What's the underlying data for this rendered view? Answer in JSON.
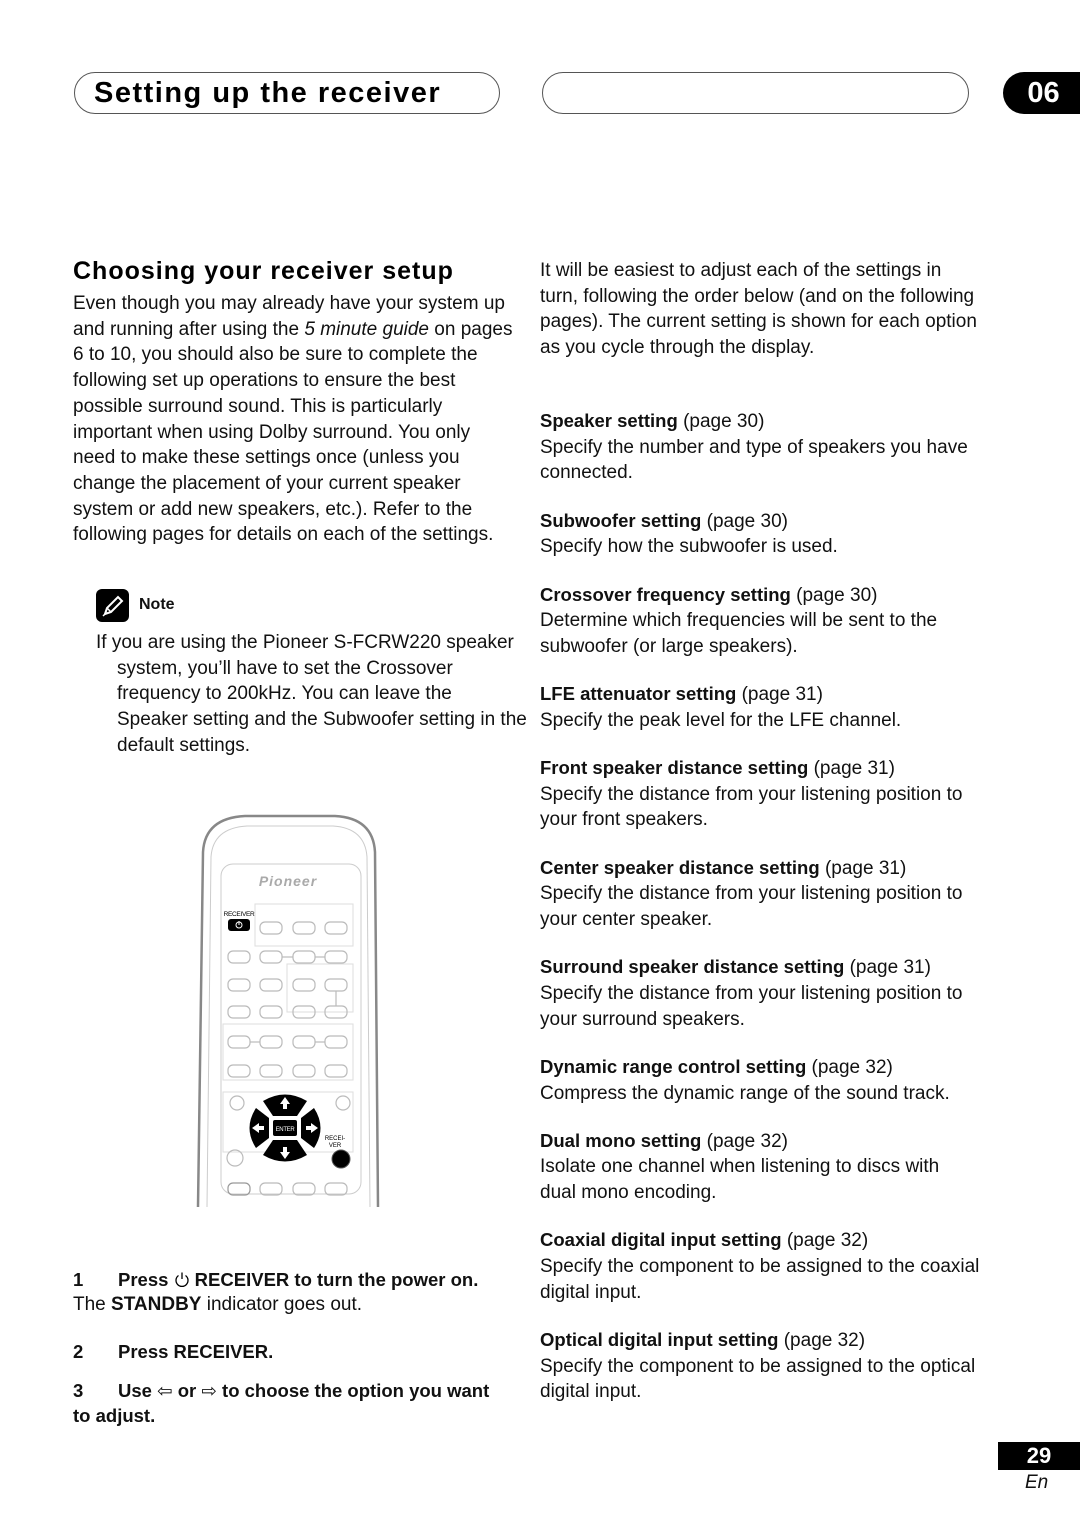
{
  "header": {
    "title": "Setting up the receiver",
    "chapter": "06"
  },
  "left": {
    "section_title": "Choosing your receiver setup",
    "intro_parts": {
      "a": "Even though you may already have your system up and running after using the ",
      "italic": "5 minute guide",
      "b": " on pages 6 to 10, you should also be sure to complete the following set up operations to ensure the best possible surround sound. This is particularly important when using Dolby surround. You only need to make these settings once (unless you change the placement of your current speaker system or add new speakers, etc.). Refer to the following pages for details on each of the settings."
    },
    "note": {
      "icon": "pencil-icon",
      "label": "Note",
      "text": "If you are using the Pioneer S-FCRW220 speaker system, you’ll have to set the Crossover frequency to 200kHz. You can leave the Speaker setting and the Subwoofer setting in the default settings."
    },
    "remote": {
      "brand": "Pioneer",
      "receiver_label": "RECEIVER",
      "enter_label": "ENTER",
      "receiver_label_2a": "RECEI-",
      "receiver_label_2b": "VER"
    },
    "steps": [
      {
        "num": "1",
        "text_a": "Press ",
        "icon": "power-icon",
        "text_b": " RECEIVER to turn the power on.",
        "sub_a": "The ",
        "sub_bold": "STANDBY",
        "sub_b": " indicator goes out."
      },
      {
        "num": "2",
        "text": "Press RECEIVER."
      },
      {
        "num": "3",
        "text_a": "Use ",
        "left_arrow": "⇦",
        "text_or": " or ",
        "right_arrow": "⇨",
        "text_b": " to choose the option you want to adjust."
      }
    ]
  },
  "right": {
    "intro": "It will be easiest to adjust each of the settings in turn, following the order below (and on the following pages). The current setting is shown for each option as you cycle through the display.",
    "settings": [
      {
        "name": "Speaker setting",
        "page": "(page 30)",
        "desc": "Specify the number and type of speakers you have connected."
      },
      {
        "name": "Subwoofer setting",
        "page": "(page 30)",
        "desc": "Specify how the subwoofer is used."
      },
      {
        "name": "Crossover frequency setting",
        "page": "(page 30)",
        "desc": "Determine which frequencies will be sent to the subwoofer (or large speakers)."
      },
      {
        "name": "LFE attenuator setting",
        "page": "(page 31)",
        "desc": "Specify the peak level for the LFE channel."
      },
      {
        "name": "Front speaker distance setting",
        "page": "(page 31)",
        "desc": "Specify the distance from your listening position to your front speakers."
      },
      {
        "name": "Center speaker distance setting",
        "page": "(page 31)",
        "desc": "Specify the distance from your listening position to your center speaker."
      },
      {
        "name": "Surround speaker distance setting",
        "page": "(page 31)",
        "desc": "Specify the distance from your listening position to your surround speakers."
      },
      {
        "name": "Dynamic range control setting",
        "page": "(page 32)",
        "desc": "Compress the dynamic range of the sound track."
      },
      {
        "name": "Dual mono setting",
        "page": "(page 32)",
        "desc": "Isolate one channel when listening to discs with dual mono encoding."
      },
      {
        "name": "Coaxial digital input setting",
        "page": "(page 32)",
        "desc": "Specify the component to be assigned to the coaxial digital input."
      },
      {
        "name": "Optical digital input setting",
        "page": " (page 32)",
        "desc": "Specify the component to be assigned to the optical digital input."
      }
    ]
  },
  "footer": {
    "page_number": "29",
    "language": "En"
  }
}
